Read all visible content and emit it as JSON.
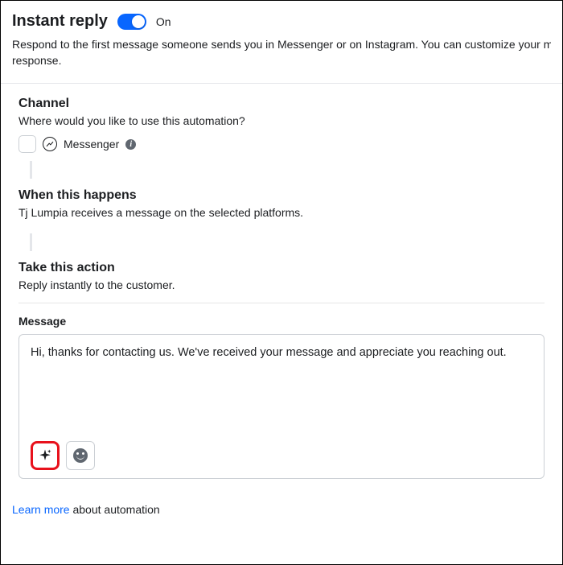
{
  "header": {
    "title": "Instant reply",
    "toggle_state": "On",
    "description_line1": "Respond to the first message someone sends you in Messenger or on Instagram. You can customize your mess",
    "description_line2": "response."
  },
  "channel": {
    "title": "Channel",
    "subtitle": "Where would you like to use this automation?",
    "option_label": "Messenger",
    "info_glyph": "i"
  },
  "when": {
    "title": "When this happens",
    "subtitle": "Tj Lumpia receives a message on the selected platforms."
  },
  "action": {
    "title": "Take this action",
    "subtitle": "Reply instantly to the customer."
  },
  "message": {
    "label": "Message",
    "text": "Hi, thanks for contacting us. We've received your message and appreciate you reaching out."
  },
  "footer": {
    "link_text": "Learn more",
    "rest_text": " about automation"
  }
}
